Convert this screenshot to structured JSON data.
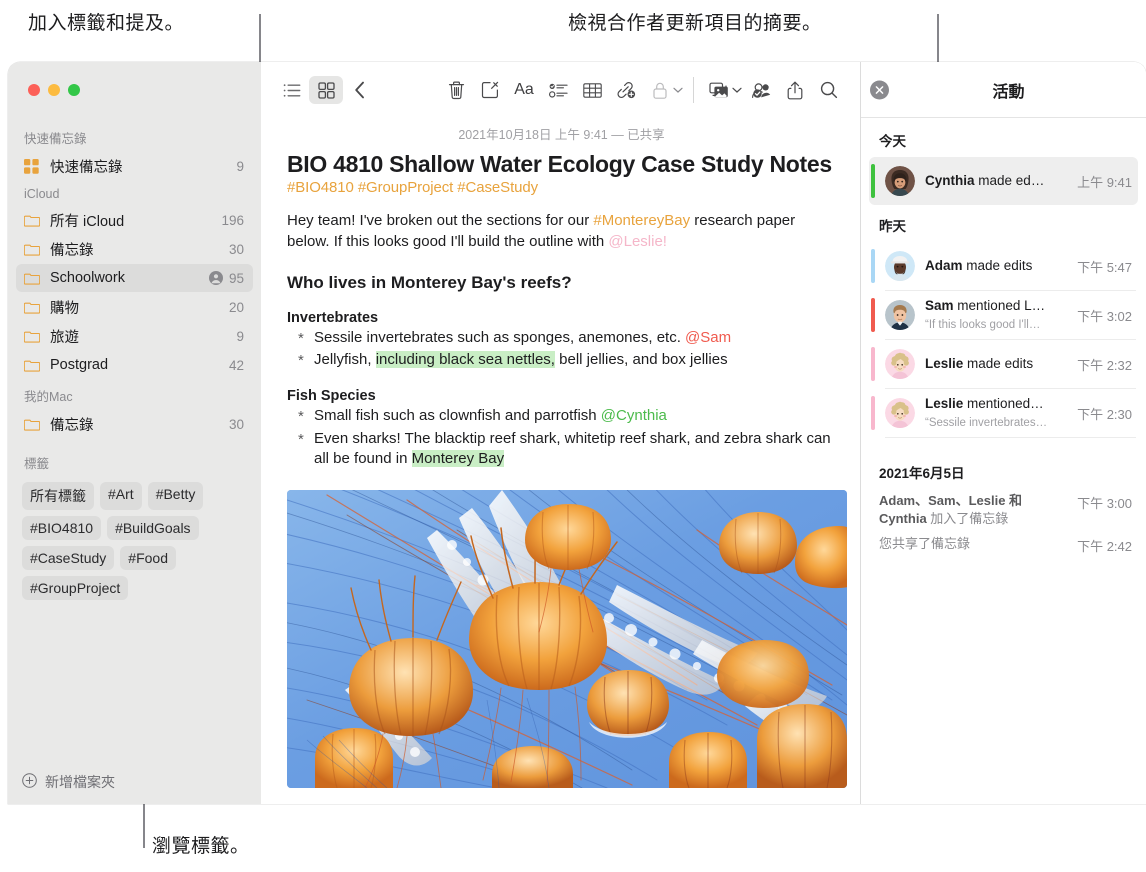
{
  "callouts": [
    {
      "id": "tags-mentions",
      "text": "加入標籤和提及。"
    },
    {
      "id": "activity-summary",
      "text": "檢視合作者更新項目的摘要。"
    },
    {
      "id": "browse-tags",
      "text": "瀏覽標籤。"
    }
  ],
  "window": {
    "traffic_lights": [
      "close",
      "minimize",
      "zoom"
    ]
  },
  "sidebar": {
    "sections": [
      {
        "title": "快速備忘錄",
        "rows": [
          {
            "icon": "quicknote-icon",
            "label": "快速備忘錄",
            "count": "9",
            "shared": false,
            "selected": false
          }
        ]
      },
      {
        "title": "iCloud",
        "rows": [
          {
            "icon": "folder-icon",
            "label": "所有 iCloud",
            "count": "196",
            "shared": false,
            "selected": false
          },
          {
            "icon": "folder-icon",
            "label": "備忘錄",
            "count": "30",
            "shared": false,
            "selected": false
          },
          {
            "icon": "folder-icon",
            "label": "Schoolwork",
            "count": "95",
            "shared": true,
            "selected": true
          },
          {
            "icon": "folder-icon",
            "label": "購物",
            "count": "20",
            "shared": false,
            "selected": false
          },
          {
            "icon": "folder-icon",
            "label": "旅遊",
            "count": "9",
            "shared": false,
            "selected": false
          },
          {
            "icon": "folder-icon",
            "label": "Postgrad",
            "count": "42",
            "shared": false,
            "selected": false
          }
        ]
      },
      {
        "title": "我的Mac",
        "rows": [
          {
            "icon": "folder-icon",
            "label": "備忘錄",
            "count": "30",
            "shared": false,
            "selected": false
          }
        ]
      }
    ],
    "tags_section_title": "標籤",
    "tags": [
      "所有標籤",
      "#Art",
      "#Betty",
      "#BIO4810",
      "#BuildGoals",
      "#CaseStudy",
      "#Food",
      "#GroupProject"
    ],
    "add_folder_label": "新增檔案夾"
  },
  "toolbar": {
    "left": [
      {
        "icon": "list-view-icon",
        "active": false
      },
      {
        "icon": "gallery-view-icon",
        "active": true
      },
      {
        "icon": "back-chevron-icon",
        "active": false
      }
    ],
    "right": [
      {
        "icon": "trash-icon",
        "chevron": false
      },
      {
        "icon": "compose-note-icon",
        "chevron": false
      },
      {
        "icon": "format-Aa-icon",
        "chevron": false,
        "glyph": "Aa"
      },
      {
        "icon": "checklist-icon",
        "chevron": false
      },
      {
        "icon": "table-icon",
        "chevron": false
      },
      {
        "icon": "link-add-icon",
        "chevron": false
      },
      {
        "icon": "lock-icon",
        "chevron": true
      }
    ],
    "far_right": [
      {
        "icon": "media-icon",
        "chevron": true
      },
      {
        "icon": "add-collaborator-icon",
        "chevron": false
      },
      {
        "icon": "share-icon",
        "chevron": false
      },
      {
        "icon": "search-icon",
        "chevron": false
      }
    ]
  },
  "note": {
    "date_line": "2021年10月18日 上午 9:41 — 已共享",
    "title": "BIO 4810 Shallow Water Ecology Case Study Notes",
    "tag_line": "#BIO4810 #GroupProject #CaseStudy",
    "intro": {
      "part1": "Hey team! I've broken out the sections for our ",
      "tag": "#MontereyBay",
      "part2": " research paper below. If this looks good I'll build the outline with ",
      "mention": "@Leslie!"
    },
    "heading": "Who lives in Monterey Bay's reefs?",
    "groups": [
      {
        "subheading": "Invertebrates",
        "items": [
          {
            "pre": "Sessile invertebrates such as sponges, anemones, etc. ",
            "mention": "@Sam",
            "mention_color": "red",
            "post": ""
          },
          {
            "pre": "Jellyfish, ",
            "highlight": "including black sea nettles,",
            "post": " bell jellies, and box jellies"
          }
        ]
      },
      {
        "subheading": "Fish Species",
        "items": [
          {
            "pre": "Small fish such as clownfish and parrotfish ",
            "mention": "@Cynthia",
            "mention_color": "green",
            "post": ""
          },
          {
            "pre": "Even sharks! The blacktip reef shark, whitetip reef shark, and zebra shark can all be found in ",
            "highlight": "Monterey Bay",
            "post": ""
          }
        ]
      }
    ],
    "image_alt": "jellyfish-photo"
  },
  "activity": {
    "title": "活動",
    "close_icon": "close-icon",
    "groups": [
      {
        "title": "今天",
        "items": [
          {
            "name": "Cynthia",
            "action": "made ed…",
            "detail": "",
            "time": "上午 9:41",
            "bar_color": "#3ec13e",
            "avatar": "cynthia",
            "highlight": true
          }
        ]
      },
      {
        "title": "昨天",
        "items": [
          {
            "name": "Adam",
            "action": "made edits",
            "detail": "",
            "time": "下午 5:47",
            "bar_color": "#a9d7f5",
            "avatar": "adam",
            "highlight": false
          },
          {
            "name": "Sam",
            "action": "mentioned L…",
            "detail": "“If this looks good I'll…",
            "time": "下午 3:02",
            "bar_color": "#f05b4f",
            "avatar": "sam",
            "highlight": false
          },
          {
            "name": "Leslie",
            "action": "made edits",
            "detail": "",
            "time": "下午 2:32",
            "bar_color": "#f8b7cd",
            "avatar": "leslie",
            "highlight": false
          },
          {
            "name": "Leslie",
            "action": "mentioned…",
            "detail": "“Sessile invertebrates…",
            "time": "下午 2:30",
            "bar_color": "#f8b7cd",
            "avatar": "leslie",
            "highlight": false
          }
        ]
      }
    ],
    "older": {
      "date_title": "2021年6月5日",
      "entries": [
        {
          "bold": "Adam、Sam、Leslie 和 Cynthia",
          "rest": " 加入了備忘錄",
          "time": "下午 3:00"
        },
        {
          "bold": "",
          "rest": "您共享了備忘錄",
          "time": "下午 2:42"
        }
      ]
    }
  },
  "colors": {
    "accent_orange": "#e8a33d",
    "highlight_green": "#c9eec5",
    "sidebar_bg": "#e9e9e8",
    "selected_row": "#dcdcdb"
  }
}
